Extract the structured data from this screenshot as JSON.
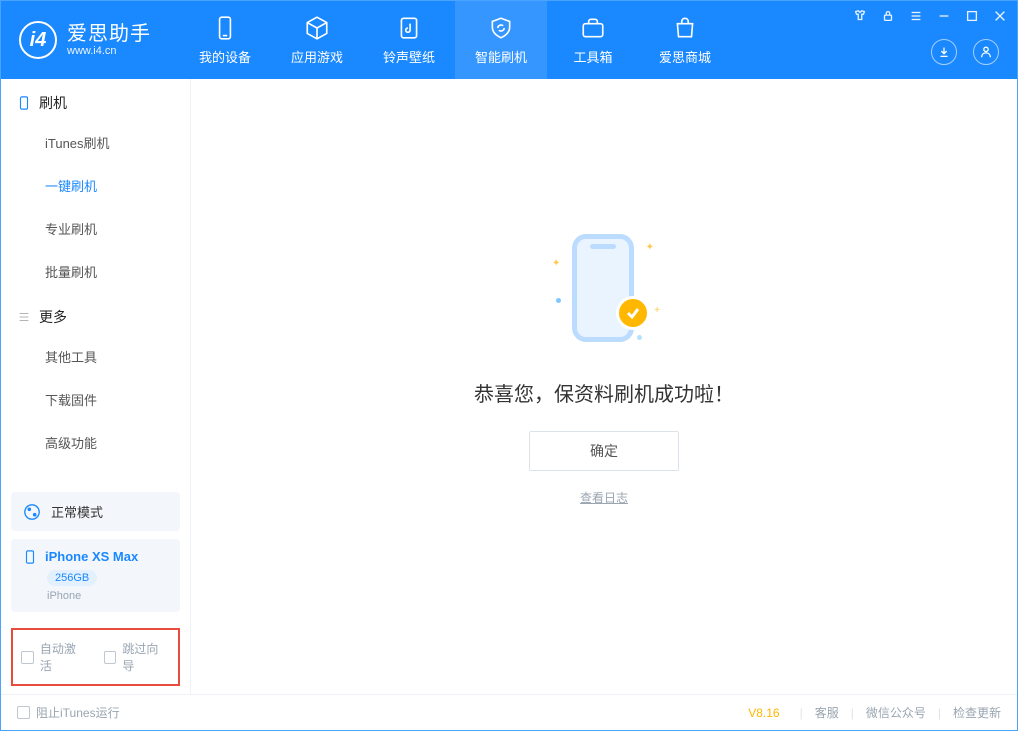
{
  "app": {
    "title": "爱思助手",
    "url": "www.i4.cn"
  },
  "nav": {
    "items": [
      {
        "label": "我的设备"
      },
      {
        "label": "应用游戏"
      },
      {
        "label": "铃声壁纸"
      },
      {
        "label": "智能刷机"
      },
      {
        "label": "工具箱"
      },
      {
        "label": "爱思商城"
      }
    ]
  },
  "sidebar": {
    "section1": {
      "title": "刷机",
      "items": [
        "iTunes刷机",
        "一键刷机",
        "专业刷机",
        "批量刷机"
      ]
    },
    "section2": {
      "title": "更多",
      "items": [
        "其他工具",
        "下载固件",
        "高级功能"
      ]
    },
    "mode": "正常模式",
    "device": {
      "name": "iPhone XS Max",
      "capacity": "256GB",
      "type": "iPhone"
    },
    "checkboxes": {
      "auto_activate": "自动激活",
      "skip_guide": "跳过向导"
    }
  },
  "main": {
    "success_text": "恭喜您，保资料刷机成功啦！",
    "ok_button": "确定",
    "log_link": "查看日志"
  },
  "footer": {
    "block_itunes": "阻止iTunes运行",
    "version": "V8.16",
    "links": [
      "客服",
      "微信公众号",
      "检查更新"
    ]
  }
}
